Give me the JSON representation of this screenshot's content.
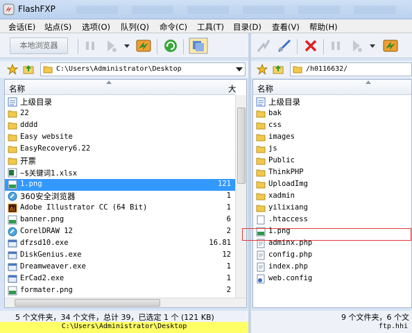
{
  "window": {
    "title": "FlashFXP"
  },
  "menu": [
    "会话(E)",
    "站点(S)",
    "选项(O)",
    "队列(Q)",
    "命令(C)",
    "工具(T)",
    "目录(D)",
    "查看(V)",
    "帮助(H)"
  ],
  "toolbar": {
    "local_browser": "本地浏览器"
  },
  "left": {
    "address": "C:\\Users\\Administrator\\Desktop",
    "col_name": "名称",
    "col_size": "大",
    "items": [
      {
        "name": "上级目录",
        "size": "",
        "icon": "up-folder-icon",
        "cjk": true
      },
      {
        "name": "22",
        "size": "",
        "icon": "folder-icon"
      },
      {
        "name": "dddd",
        "size": "",
        "icon": "folder-icon"
      },
      {
        "name": "Easy website",
        "size": "",
        "icon": "folder-icon"
      },
      {
        "name": "EasyRecovery6.22",
        "size": "",
        "icon": "folder-icon"
      },
      {
        "name": "开票",
        "size": "",
        "icon": "folder-icon",
        "cjk": true
      },
      {
        "name": "~$关键词1.xlsx",
        "size": "",
        "icon": "excel-file-icon"
      },
      {
        "name": "1.png",
        "size": "121",
        "icon": "png-file-icon",
        "selected": true
      },
      {
        "name": "360安全浏览器",
        "size": "1",
        "icon": "shortcut-icon",
        "cjk": true
      },
      {
        "name": "Adobe Illustrator CC (64 Bit)",
        "size": "1",
        "icon": "illustrator-icon"
      },
      {
        "name": "banner.png",
        "size": "6",
        "icon": "png-file-icon"
      },
      {
        "name": "CorelDRAW 12",
        "size": "2",
        "icon": "shortcut-icon"
      },
      {
        "name": "dfzsd10.exe",
        "size": "16.81",
        "icon": "exe-file-icon"
      },
      {
        "name": "DiskGenius.exe",
        "size": "12",
        "icon": "exe-file-icon"
      },
      {
        "name": "Dreamweaver.exe",
        "size": "1",
        "icon": "exe-file-icon"
      },
      {
        "name": "ErCad2.exe",
        "size": "1",
        "icon": "exe-file-icon"
      },
      {
        "name": "formater.png",
        "size": "2",
        "icon": "png-file-icon"
      }
    ],
    "status": "5 个文件夹，34 个文件，总计 39，已选定 1 个 (121 KB)",
    "path": "C:\\Users\\Administrator\\Desktop"
  },
  "right": {
    "address": "/h0116632/",
    "col_name": "名称",
    "items": [
      {
        "name": "上级目录",
        "icon": "up-folder-icon",
        "cjk": true
      },
      {
        "name": "bak",
        "icon": "folder-icon"
      },
      {
        "name": "css",
        "icon": "folder-icon"
      },
      {
        "name": "images",
        "icon": "folder-icon"
      },
      {
        "name": "js",
        "icon": "folder-icon"
      },
      {
        "name": "Public",
        "icon": "folder-icon"
      },
      {
        "name": "ThinkPHP",
        "icon": "folder-icon"
      },
      {
        "name": "UploadImg",
        "icon": "folder-icon"
      },
      {
        "name": "xadmin",
        "icon": "folder-icon"
      },
      {
        "name": "yilixiang",
        "icon": "folder-icon"
      },
      {
        "name": ".htaccess",
        "icon": "file-icon"
      },
      {
        "name": "1.png",
        "icon": "png-file-icon",
        "highlight": true
      },
      {
        "name": "adminx.php",
        "icon": "php-file-icon"
      },
      {
        "name": "config.php",
        "icon": "php-file-icon"
      },
      {
        "name": "index.php",
        "icon": "php-file-icon"
      },
      {
        "name": "web.config",
        "icon": "config-file-icon"
      }
    ],
    "status": "9 个文件夹，6 个文",
    "path": "ftp.hhi"
  },
  "colors": {
    "selection": "#3399ff",
    "highlight_box": "#e03a3a",
    "path_bar": "#ffff66"
  }
}
